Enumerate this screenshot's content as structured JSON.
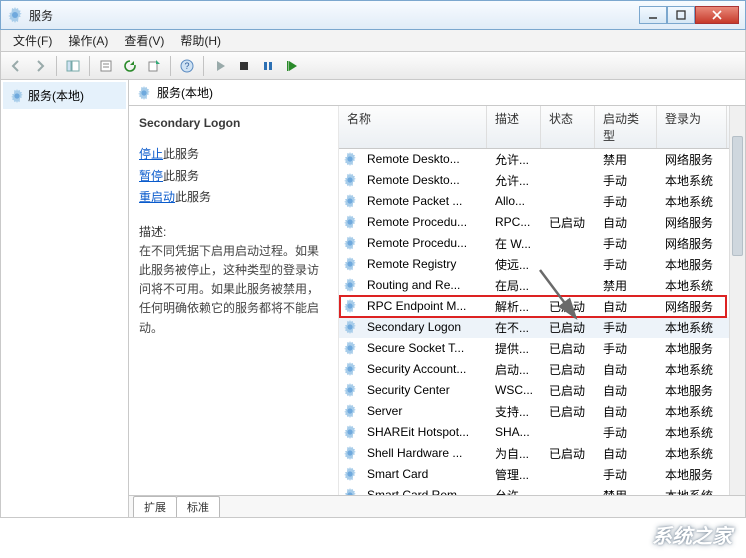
{
  "window": {
    "title": "服务"
  },
  "menus": {
    "file": "文件(F)",
    "action": "操作(A)",
    "view": "查看(V)",
    "help": "帮助(H)"
  },
  "tree": {
    "root": "服务(本地)"
  },
  "header": {
    "label": "服务(本地)"
  },
  "detail": {
    "name": "Secondary Logon",
    "stop_link": "停止",
    "stop_suffix": "此服务",
    "pause_link": "暂停",
    "pause_suffix": "此服务",
    "restart_link": "重启动",
    "restart_suffix": "此服务",
    "desc_label": "描述:",
    "description": "在不同凭据下启用启动过程。如果此服务被停止，这种类型的登录访问将不可用。如果此服务被禁用，任何明确依赖它的服务都将不能启动。"
  },
  "columns": {
    "name": "名称",
    "desc": "描述",
    "status": "状态",
    "startup": "启动类型",
    "logon": "登录为"
  },
  "services": [
    {
      "name": "Remote Deskto...",
      "desc": "允许...",
      "status": "",
      "startup": "禁用",
      "logon": "网络服务"
    },
    {
      "name": "Remote Deskto...",
      "desc": "允许...",
      "status": "",
      "startup": "手动",
      "logon": "本地系统"
    },
    {
      "name": "Remote Packet ...",
      "desc": "Allo...",
      "status": "",
      "startup": "手动",
      "logon": "本地系统"
    },
    {
      "name": "Remote Procedu...",
      "desc": "RPC...",
      "status": "已启动",
      "startup": "自动",
      "logon": "网络服务"
    },
    {
      "name": "Remote Procedu...",
      "desc": "在 W...",
      "status": "",
      "startup": "手动",
      "logon": "网络服务"
    },
    {
      "name": "Remote Registry",
      "desc": "使远...",
      "status": "",
      "startup": "手动",
      "logon": "本地服务"
    },
    {
      "name": "Routing and Re...",
      "desc": "在局...",
      "status": "",
      "startup": "禁用",
      "logon": "本地系统"
    },
    {
      "name": "RPC Endpoint M...",
      "desc": "解析...",
      "status": "已启动",
      "startup": "自动",
      "logon": "网络服务"
    },
    {
      "name": "Secondary Logon",
      "desc": "在不...",
      "status": "已启动",
      "startup": "手动",
      "logon": "本地系统",
      "selected": true
    },
    {
      "name": "Secure Socket T...",
      "desc": "提供...",
      "status": "已启动",
      "startup": "手动",
      "logon": "本地服务"
    },
    {
      "name": "Security Account...",
      "desc": "启动...",
      "status": "已启动",
      "startup": "自动",
      "logon": "本地系统"
    },
    {
      "name": "Security Center",
      "desc": "WSC...",
      "status": "已启动",
      "startup": "自动",
      "logon": "本地服务"
    },
    {
      "name": "Server",
      "desc": "支持...",
      "status": "已启动",
      "startup": "自动",
      "logon": "本地系统"
    },
    {
      "name": "SHAREit Hotspot...",
      "desc": "SHA...",
      "status": "",
      "startup": "手动",
      "logon": "本地系统"
    },
    {
      "name": "Shell Hardware ...",
      "desc": "为自...",
      "status": "已启动",
      "startup": "自动",
      "logon": "本地系统"
    },
    {
      "name": "Smart Card",
      "desc": "管理...",
      "status": "",
      "startup": "手动",
      "logon": "本地服务"
    },
    {
      "name": "Smart Card Rem...",
      "desc": "允许...",
      "status": "",
      "startup": "禁用",
      "logon": "本地系统"
    }
  ],
  "tabs": {
    "extended": "扩展",
    "standard": "标准"
  },
  "watermark": "系统之家"
}
